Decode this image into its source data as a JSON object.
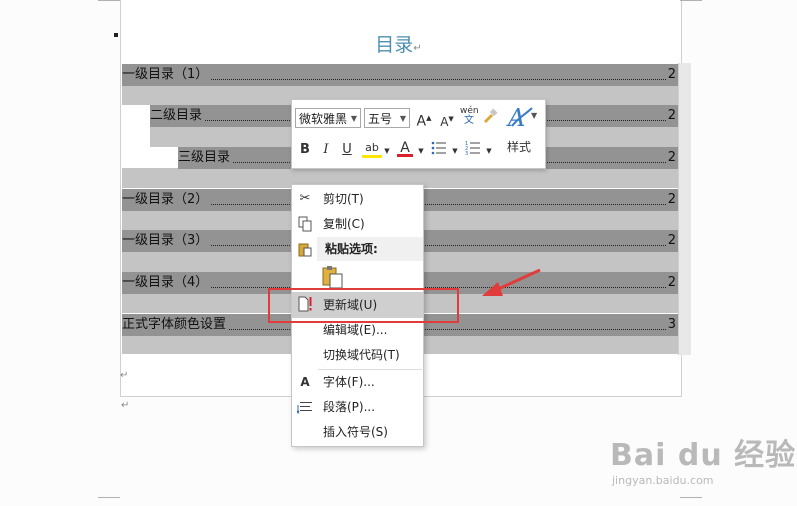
{
  "document": {
    "title": "目录",
    "para_mark": "↵",
    "toc_entries": [
      {
        "text": "一级目录（1）",
        "page": "2"
      },
      {
        "text": "二级目录",
        "page": "2"
      },
      {
        "text": "三级目录",
        "page": "2"
      },
      {
        "text": "一级目录（2）",
        "page": "2"
      },
      {
        "text": "一级目录（3）",
        "page": "2"
      },
      {
        "text": "一级目录（4）",
        "page": "2"
      },
      {
        "text": "正式字体颜色设置",
        "page": "3"
      }
    ]
  },
  "mini_toolbar": {
    "font_name": "微软雅黑",
    "font_size": "五号",
    "grow_font": "A",
    "shrink_font": "A",
    "phonetic_top": "wén",
    "phonetic_bottom": "文",
    "bold": "B",
    "italic": "I",
    "underline": "U",
    "highlight": "ab",
    "font_color": "A",
    "styles_label": "样式"
  },
  "context_menu": {
    "items": [
      {
        "label": "剪切(T)",
        "icon": "scissors-icon"
      },
      {
        "label": "复制(C)",
        "icon": "copy-icon"
      },
      {
        "label": "粘贴选项:",
        "icon": "paste-icon"
      },
      {
        "label": "更新域(U)",
        "icon": "update-field-icon",
        "highlighted": true
      },
      {
        "label": "编辑域(E)...",
        "icon": ""
      },
      {
        "label": "切换域代码(T)",
        "icon": ""
      },
      {
        "label": "字体(F)...",
        "icon": "font-icon"
      },
      {
        "label": "段落(P)...",
        "icon": "paragraph-icon"
      },
      {
        "label": "插入符号(S)",
        "icon": ""
      }
    ]
  },
  "watermark": {
    "brand": "Bai du 经验",
    "url": "jingyan.baidu.com"
  },
  "colors": {
    "highlight_arrow": "#e23b3b",
    "title": "#4d8fb0",
    "field_shading": "#939393"
  }
}
